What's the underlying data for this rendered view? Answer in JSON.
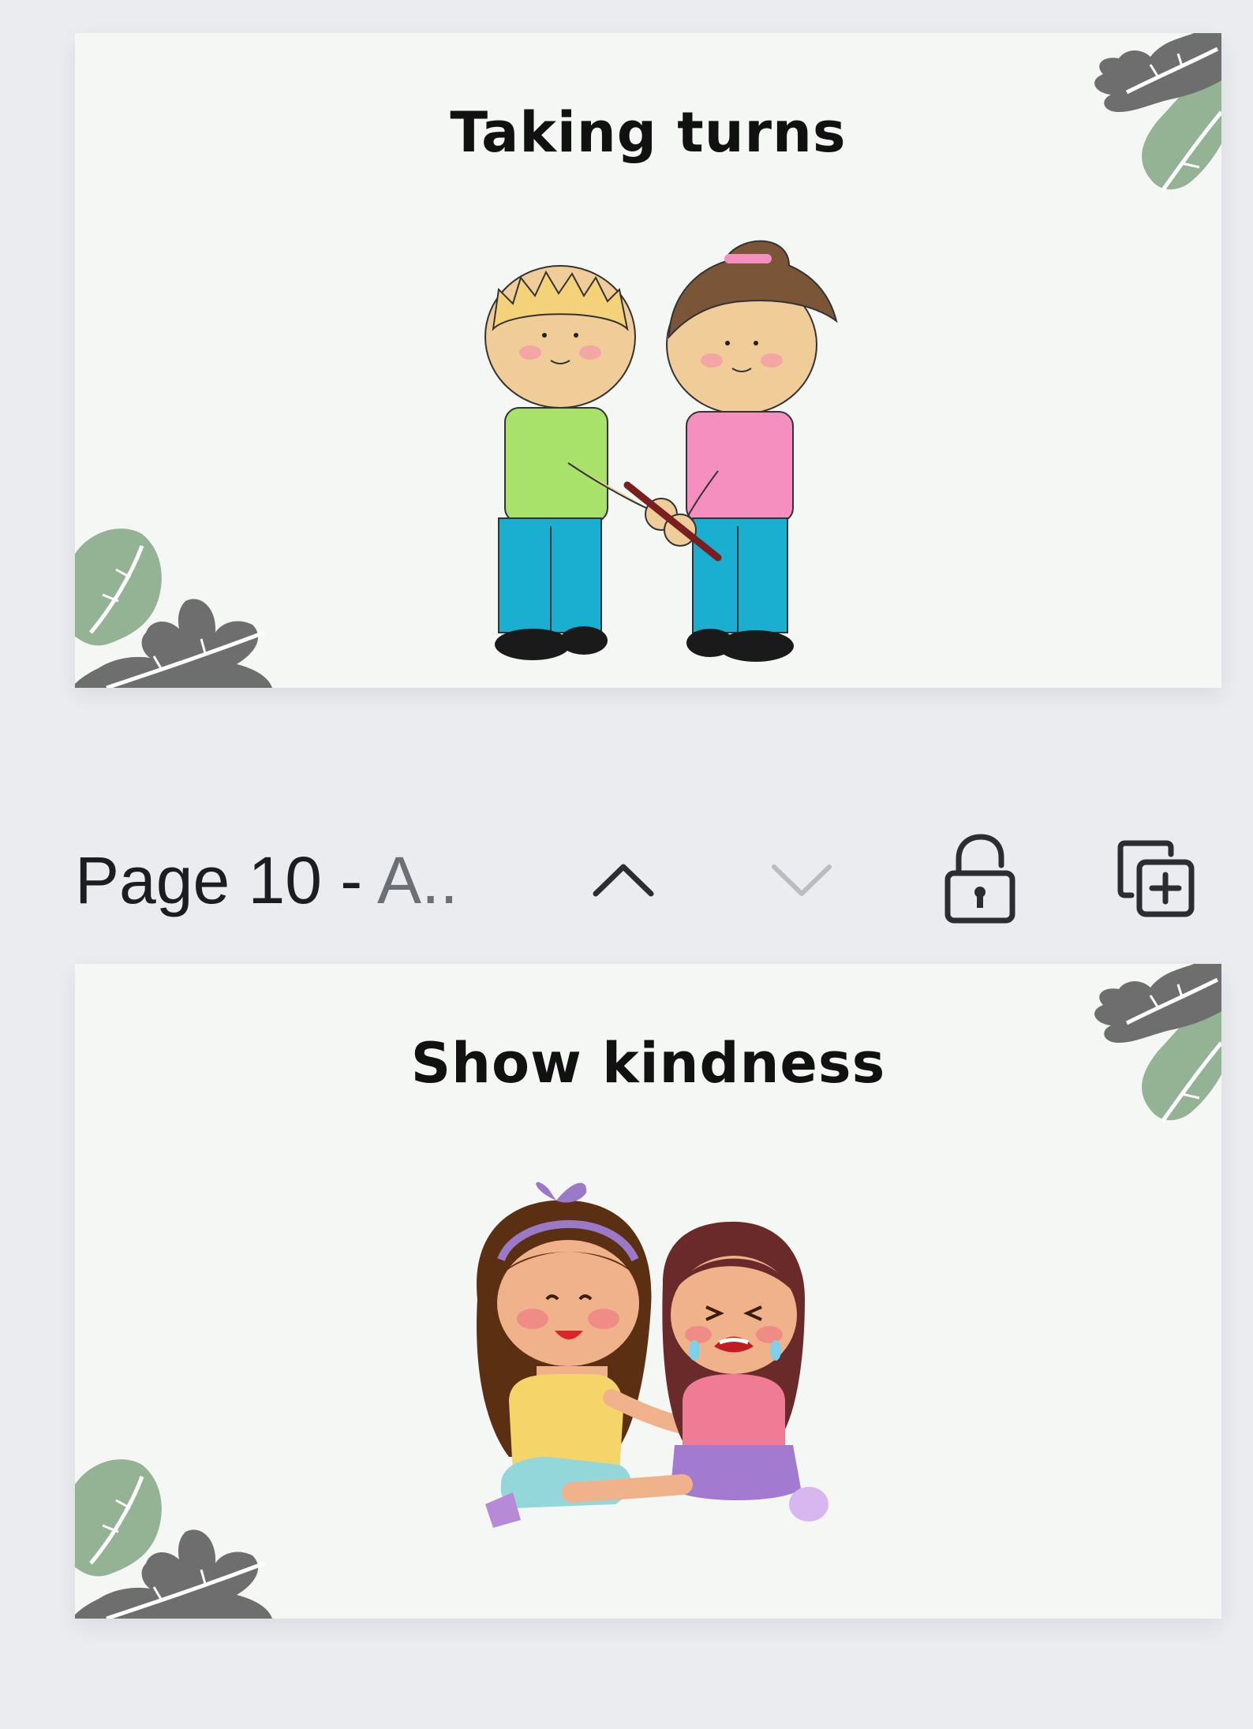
{
  "pages": [
    {
      "title": "Taking turns"
    },
    {
      "title": "Show kindness"
    }
  ],
  "page_bar": {
    "number_label": "Page 10 - ",
    "name_truncated": "A..",
    "move_up_icon": "chevron-up-icon",
    "move_down_icon": "chevron-down-icon",
    "lock_icon": "unlock-icon",
    "duplicate_icon": "duplicate-page-icon"
  },
  "colors": {
    "canvas_bg": "#ebecf0",
    "slide_bg": "#f5f7f5",
    "leaf_green": "#93b394",
    "leaf_gray": "#6e6e6e",
    "icon_active": "#2b2d33",
    "icon_disabled": "#b9bcc2"
  }
}
